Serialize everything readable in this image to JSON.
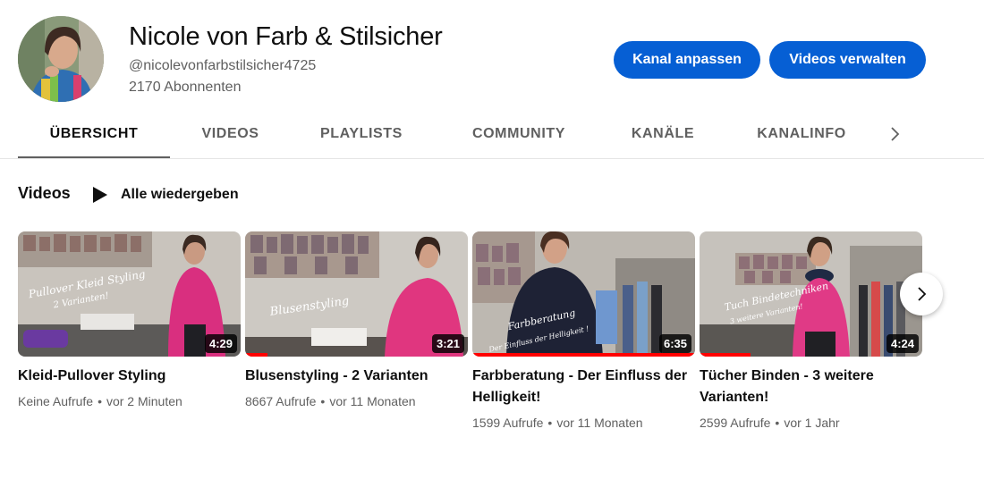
{
  "channel": {
    "name": "Nicole von Farb & Stilsicher",
    "handle": "@nicolevonfarbstilsicher4725",
    "subscribers": "2170 Abonnenten",
    "customize_label": "Kanal anpassen",
    "manage_label": "Videos verwalten",
    "accent_color": "#065fd4"
  },
  "tabs": [
    {
      "label": "ÜBERSICHT",
      "active": true
    },
    {
      "label": "VIDEOS",
      "active": false
    },
    {
      "label": "PLAYLISTS",
      "active": false
    },
    {
      "label": "COMMUNITY",
      "active": false
    },
    {
      "label": "KANÄLE",
      "active": false
    },
    {
      "label": "KANALINFO",
      "active": false
    }
  ],
  "section": {
    "title": "Videos",
    "play_all_label": "Alle wiedergeben"
  },
  "videos": [
    {
      "title": "Kleid-Pullover Styling",
      "duration": "4:29",
      "views": "Keine Aufrufe",
      "age": "vor 2 Minuten",
      "overlay_text": "Pullover Kleid Styling",
      "overlay_sub": "2 Varianten!",
      "watched_fraction": 0
    },
    {
      "title": "Blusenstyling - 2 Varianten",
      "duration": "3:21",
      "views": "8667 Aufrufe",
      "age": "vor 11 Monaten",
      "overlay_text": "Blusenstyling",
      "overlay_sub": "",
      "watched_fraction": 0.1
    },
    {
      "title": "Farbberatung - Der Einfluss der Helligkeit!",
      "duration": "6:35",
      "views": "1599 Aufrufe",
      "age": "vor 11 Monaten",
      "overlay_text": "Farbberatung",
      "overlay_sub": "Der Einfluss der Helligkeit !",
      "watched_fraction": 1.0
    },
    {
      "title": "Tücher Binden - 3 weitere Varianten!",
      "duration": "4:24",
      "views": "2599 Aufrufe",
      "age": "vor 1 Jahr",
      "overlay_text": "Tuch Bindetechniken",
      "overlay_sub": "3 weitere Varianten!",
      "watched_fraction": 0.23
    }
  ],
  "meta_separator": "•",
  "icons": {
    "tabs_next": "chevron-right-icon",
    "play_all": "play-icon",
    "carousel_next": "chevron-right-icon"
  }
}
